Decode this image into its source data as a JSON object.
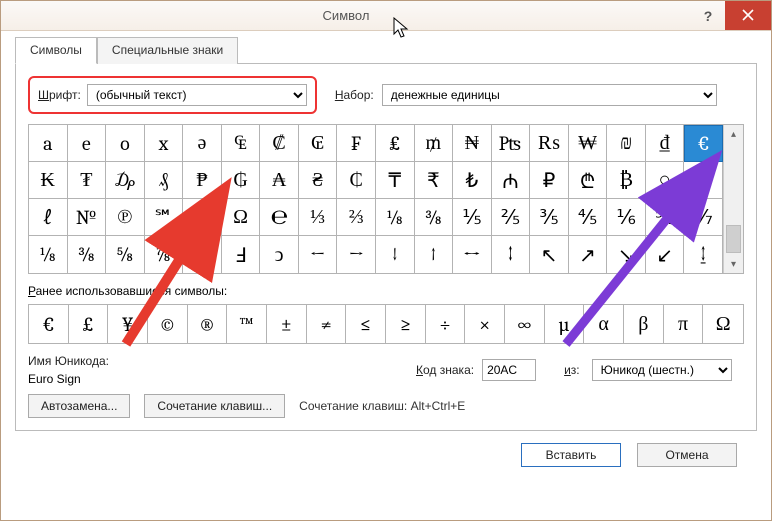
{
  "window": {
    "title": "Символ"
  },
  "tabs": [
    "Символы",
    "Специальные знаки"
  ],
  "fontLabel": "Шрифт:",
  "fontValue": "(обычный текст)",
  "subsetLabel": "Набор:",
  "subsetValue": "денежные единицы",
  "grid": [
    [
      "a",
      "e",
      "o",
      "x",
      "ə",
      "₠",
      "₡",
      "₢",
      "₣",
      "₤",
      "₥",
      "₦",
      "₧",
      "₨",
      "₩",
      "₪",
      "₫",
      "€"
    ],
    [
      "₭",
      "₮",
      "₯",
      "₰",
      "₱",
      "₲",
      "₳",
      "₴",
      "₵",
      "₸",
      "₹",
      "₺",
      "₼",
      "₽",
      "₾",
      "₿",
      "○",
      "%"
    ],
    [
      "ℓ",
      "№",
      "℗",
      "℠",
      "™",
      "Ω",
      "℮",
      "⅓",
      "⅔",
      "⅛",
      "⅜",
      "⅕",
      "⅖",
      "⅗",
      "⅘",
      "⅙",
      "⅚",
      "⅐"
    ],
    [
      "⅛",
      "⅜",
      "⅝",
      "⅞",
      "⅟",
      "Ⅎ",
      "ↄ",
      "←",
      "→",
      "↓",
      "↑",
      "↔",
      "↕",
      "↖",
      "↗",
      "↘",
      "↙",
      "↨"
    ]
  ],
  "selected": {
    "row": 0,
    "col": 17
  },
  "recentLabel": "Ранее использовавшиеся символы:",
  "recent": [
    "€",
    "£",
    "¥",
    "©",
    "®",
    "™",
    "±",
    "≠",
    "≤",
    "≥",
    "÷",
    "×",
    "∞",
    "µ",
    "α",
    "β",
    "π",
    "Ω"
  ],
  "unicodeNameLabel": "Имя Юникода:",
  "unicodeName": "Euro Sign",
  "codeLabel": "Код знака:",
  "codeValue": "20AC",
  "fromLabel": "из:",
  "fromValue": "Юникод (шестн.)",
  "autocorrectBtn": "Автозамена...",
  "shortcutBtn": "Сочетание клавиш...",
  "shortcutLabel": "Сочетание клавиш:",
  "shortcutValue": "Alt+Ctrl+E",
  "insertBtn": "Вставить",
  "cancelBtn": "Отмена"
}
